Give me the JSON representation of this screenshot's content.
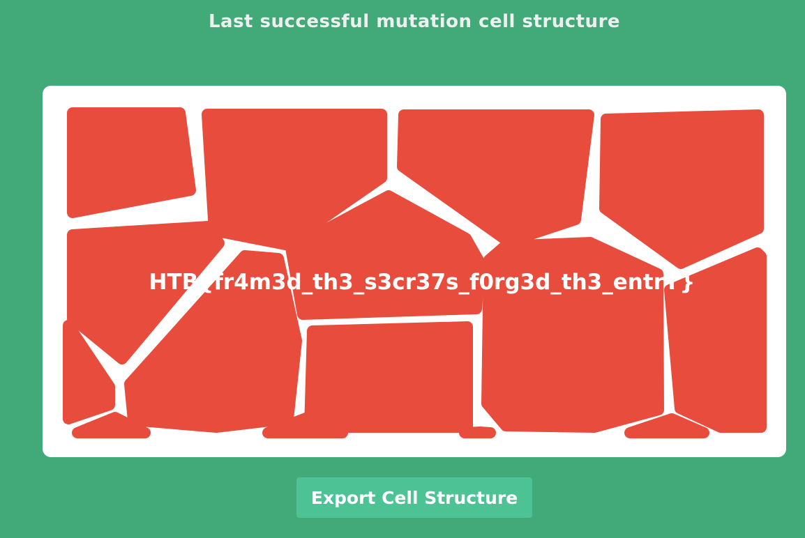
{
  "page": {
    "title": "Last successful mutation cell structure"
  },
  "canvas": {
    "flag_text": "HTB{fr4m3d_th3_s3cr37s_f0rg3d_th3_entrY}",
    "background_color": "#ffffff",
    "cell_color": "#e74c3c"
  },
  "export": {
    "button_label": "Export Cell Structure"
  },
  "colors": {
    "page_background": "#41aa78",
    "button_background": "#4cc295",
    "text": "#ffffff"
  }
}
